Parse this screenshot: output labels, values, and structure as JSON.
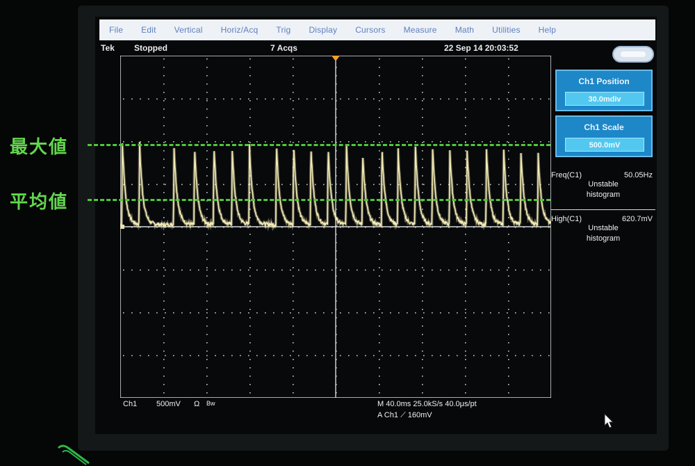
{
  "menu": {
    "items": [
      "File",
      "Edit",
      "Vertical",
      "Horiz/Acq",
      "Trig",
      "Display",
      "Cursors",
      "Measure",
      "Math",
      "Utilities",
      "Help"
    ]
  },
  "status": {
    "brand": "Tek",
    "run_state": "Stopped",
    "acquisitions": "7 Acqs",
    "datetime": "22 Sep 14 20:03:52"
  },
  "panels": {
    "position_title": "Ch1 Position",
    "position_value": "30.0mdiv",
    "scale_title": "Ch1 Scale",
    "scale_value": "500.0mV"
  },
  "measurements": [
    {
      "name": "Freq(C1)",
      "value": "50.05Hz",
      "status": "Unstable",
      "note": "histogram"
    },
    {
      "name": "High(C1)",
      "value": "620.7mV",
      "status": "Unstable",
      "note": "histogram"
    }
  ],
  "bottom": {
    "channel": "Ch1",
    "volts_div": "500mV",
    "coupling": "Ω",
    "bw": "Bw",
    "horizontal": "M 40.0ms 25.0kS/s 40.0μs/pt",
    "trigger": "A Ch1 ⟋ 160mV"
  },
  "overlay": {
    "max_label": "最大値",
    "avg_label": "平均値"
  },
  "colors": {
    "trace": "#f3ebb4",
    "panel_bg": "#1d87c8",
    "overlay_green": "#63d64e",
    "menu_text": "#5c7fc0"
  },
  "chart_data": {
    "type": "line",
    "title": "",
    "xlabel": "",
    "ylabel": "",
    "grid": true,
    "divisions": {
      "x": 10,
      "y": 8
    },
    "xlim": [
      0,
      400
    ],
    "ylim": [
      -4,
      4
    ],
    "x_unit": "ms",
    "y_unit": "div",
    "series": [
      {
        "baseline": 0.05,
        "pulse_times": [
          2,
          18,
          50,
          69,
          87,
          104,
          120,
          145,
          161,
          177,
          193,
          210,
          225,
          243,
          258,
          274,
          290,
          306,
          322,
          340,
          356,
          372,
          388
        ],
        "pulse_peaks": [
          1.95,
          1.95,
          1.85,
          1.85,
          1.9,
          1.8,
          1.9,
          1.95,
          1.95,
          1.9,
          1.85,
          1.9,
          1.75,
          1.85,
          1.8,
          1.9,
          1.85,
          1.8,
          1.8,
          1.8,
          1.8,
          1.75,
          1.7
        ]
      }
    ]
  }
}
